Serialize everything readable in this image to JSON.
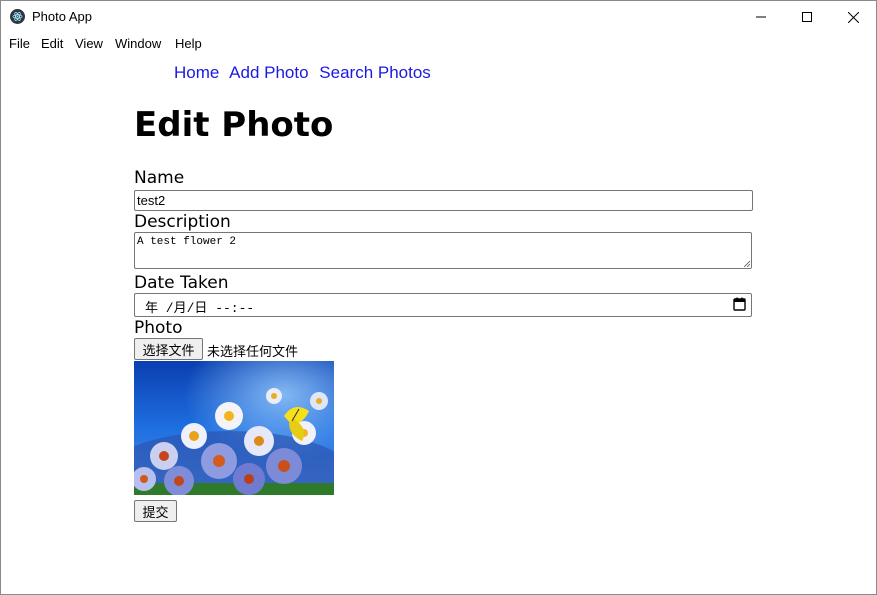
{
  "window": {
    "title": "Photo App",
    "controls": [
      "minimize",
      "maximize",
      "close"
    ]
  },
  "menu": {
    "items": [
      "File",
      "Edit",
      "View",
      "Window",
      "Help"
    ]
  },
  "nav": {
    "links": [
      "Home",
      "Add Photo",
      "Search Photos"
    ]
  },
  "page": {
    "heading": "Edit Photo"
  },
  "form": {
    "name_label": "Name",
    "name_value": "test2",
    "description_label": "Description",
    "description_value": "A test flower 2",
    "date_label": "Date Taken",
    "date_value": "年 /月/日 --:--",
    "photo_label": "Photo",
    "file_button": "选择文件",
    "file_status": "未选择任何文件",
    "submit_label": "提交"
  },
  "colors": {
    "link": "#1a1ae0",
    "button_bg": "#efefef",
    "input_border": "#767676"
  },
  "icons": [
    "electron-app-icon",
    "minimize-icon",
    "maximize-icon",
    "close-icon",
    "calendar-icon",
    "resize-grip-icon"
  ]
}
